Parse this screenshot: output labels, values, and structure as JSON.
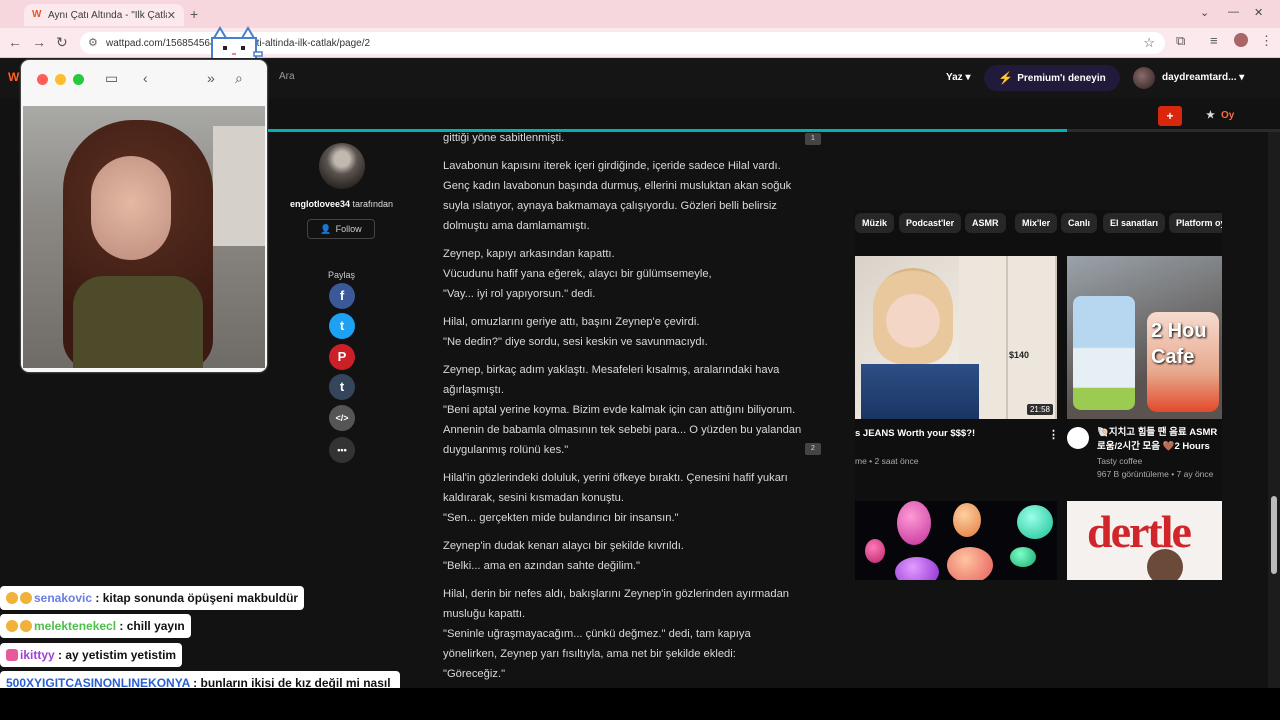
{
  "browser": {
    "tab_title": "Aynı Çatı Altında - \"İlk Çatlak\"",
    "url": "wattpad.com/1568545642-ayni-cati-altinda-ilk-catlak/page/2"
  },
  "wattpad": {
    "logo": "W",
    "search_label": "Ara",
    "write_label": "Yaz",
    "premium_label": "Premium'ı deneyin",
    "username": "daydreamtard...",
    "vote_label": "Oy",
    "reading_progress": 0.79,
    "author": {
      "name": "englotlovee34",
      "suffix": " tarafından",
      "follow_label": "Follow"
    },
    "share_label": "Paylaş",
    "share_icons": [
      {
        "name": "facebook-icon",
        "glyph": "f",
        "color": "#3b5998"
      },
      {
        "name": "twitter-icon",
        "glyph": "t",
        "color": "#1da1f2"
      },
      {
        "name": "pinterest-icon",
        "glyph": "P",
        "color": "#cb2027"
      },
      {
        "name": "tumblr-icon",
        "glyph": "t",
        "color": "#35465c"
      },
      {
        "name": "embed-icon",
        "glyph": "</>",
        "color": "#555555"
      },
      {
        "name": "more-icon",
        "glyph": "•••",
        "color": "#333333"
      }
    ],
    "comment_counts": [
      "1",
      "2"
    ],
    "paragraphs": [
      "gittiği yöne sabitlenmişti.",
      "Lavabonun kapısını iterek içeri girdiğinde, içeride sadece Hilal vardı. Genç kadın lavabonun başında durmuş, ellerini musluktan akan soğuk suyla ıslatıyor, aynaya bakmamaya çalışıyordu. Gözleri belli belirsiz dolmuştu ama damlamamıştı.",
      "Zeynep, kapıyı arkasından kapattı.\nVücudunu hafif yana eğerek, alaycı bir gülümsemeyle,\n\"Vay... iyi rol yapıyorsun.\" dedi.",
      "Hilal, omuzlarını geriye attı, başını Zeynep'e çevirdi.\n\"Ne dedin?\" diye sordu, sesi keskin ve savunmacıydı.",
      "Zeynep, birkaç adım yaklaştı. Mesafeleri kısalmış, aralarındaki hava ağırlaşmıştı.\n\"Beni aptal yerine koyma. Bizim evde kalmak için can attığını biliyorum. Annenin de babamla olmasının tek sebebi para... O yüzden bu yalandan duygulanmış rolünü kes.\"",
      "Hilal'in gözlerindeki doluluk, yerini öfkeye bıraktı. Çenesini hafif yukarı kaldırarak, sesini kısmadan konuştu.\n\"Sen... gerçekten mide bulandırıcı bir insansın.\"",
      "Zeynep'in dudak kenarı alaycı bir şekilde kıvrıldı.\n\"Belki... ama en azından sahte değilim.\"",
      "Hilal, derin bir nefes aldı, bakışlarını Zeynep'in gözlerinden ayırmadan musluğu kapattı.\n\"Seninle uğraşmayacağım... çünkü değmez.\" dedi, tam kapıya yönelirken, Zeynep yarı fısıltıyla, ama net bir şekilde ekledi:\n\"Göreceğiz.\""
    ]
  },
  "youtube": {
    "chips": [
      "Müzik",
      "Podcast'ler",
      "ASMR",
      "Mix'ler",
      "Canlı",
      "El sanatları",
      "Platform oy"
    ],
    "video1": {
      "title": "s JEANS Worth your $$$?!",
      "meta": "me • 2 saat önce",
      "duration": "21:58",
      "price": "$140"
    },
    "video2": {
      "title": "🐚지치고 힘들 땐 음료 ASMR 로움/2시간 모음 🤎2 Hours",
      "channel": "Tasty coffee",
      "meta": "967 B görüntüleme • 7 ay önce",
      "thumb_text": "2 Hou\nCafe"
    },
    "video4_text": "dertle"
  },
  "chat": [
    {
      "user": "senakovic",
      "user_color": "#6b7de6",
      "msg": ": kitap sonunda öpüşeni makbuldür"
    },
    {
      "user": "melektenekecl",
      "user_color": "#4fbf4a",
      "msg": ": chill yayın"
    },
    {
      "user": "ikittyy",
      "user_color": "#a23fd6",
      "msg": ": ay yetistim yetistim"
    },
    {
      "user": "500XYIGITCASINONLINEKONYA",
      "user_color": "#2a5fd1",
      "msg": ": bunların ikisi de kız değil mi nasıl öpüşsünler"
    }
  ]
}
